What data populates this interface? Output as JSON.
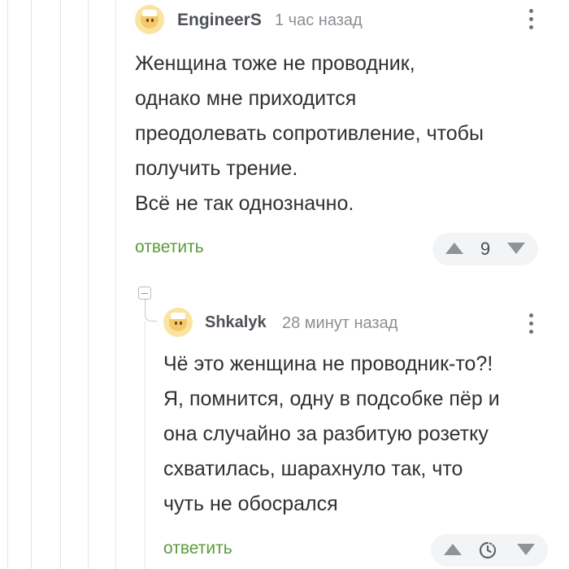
{
  "comments": [
    {
      "author": "EngineerS",
      "time": "1 час назад",
      "body": [
        "Женщина тоже не проводник,",
        "однако мне приходится",
        "преодолевать сопротивление, чтобы",
        "получить трение.",
        "Всё не так однозначно."
      ],
      "reply_label": "ответить",
      "score": "9"
    },
    {
      "author": "Shkalyk",
      "time": "28 минут назад",
      "body": [
        "Чё это женщина не проводник-то?!",
        "Я, помнится, одну в подсобке пёр и",
        "она случайно за разбитую розетку",
        "схватилась, шарахнуло так, что",
        "чуть не обосрался"
      ],
      "reply_label": "ответить",
      "score_icon": "timer-icon"
    }
  ],
  "colors": {
    "reply_link": "#5c9b3b",
    "rating_bg": "#f3f4f6",
    "thread_line": "#e3e5e8"
  }
}
